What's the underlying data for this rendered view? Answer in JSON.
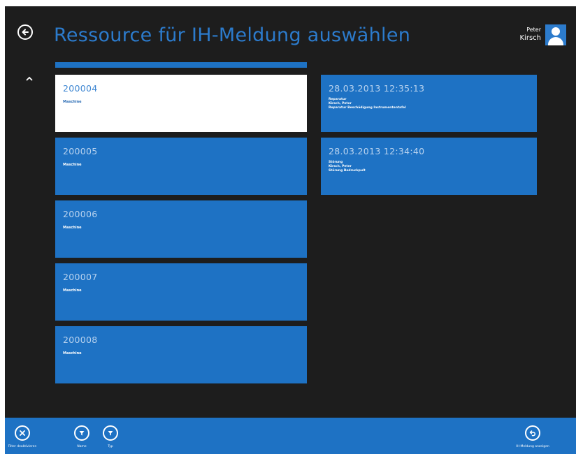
{
  "header": {
    "title": "Ressource für IH-Meldung auswählen",
    "user": {
      "first_name": "Peter",
      "last_name": "Kirsch"
    }
  },
  "resources": [
    {
      "number": "200004",
      "type": "Maschine",
      "selected": true
    },
    {
      "number": "200005",
      "type": "Maschine",
      "selected": false
    },
    {
      "number": "200006",
      "type": "Maschine",
      "selected": false
    },
    {
      "number": "200007",
      "type": "Maschine",
      "selected": false
    },
    {
      "number": "200008",
      "type": "Maschine",
      "selected": false
    }
  ],
  "events": [
    {
      "timestamp": "28.03.2013 12:35:13",
      "lines": [
        "Reparatur",
        "Kirsch, Peter",
        "Reparatur Beschädigung Instrumententafel"
      ]
    },
    {
      "timestamp": "28.03.2013 12:34:40",
      "lines": [
        "Störung",
        "Kirsch, Peter",
        "Störung Bedruckpult"
      ]
    }
  ],
  "appbar": {
    "clear_filter_label": "Filter deaktivieren",
    "name_filter_label": "Name",
    "type_filter_label": "Typ",
    "show_report_label": "IH-Meldung anzeigen"
  },
  "colors": {
    "background": "#1d1d1d",
    "tile": "#1e72c4",
    "accent": "#2c7bcc",
    "selected_tile": "#ffffff"
  }
}
